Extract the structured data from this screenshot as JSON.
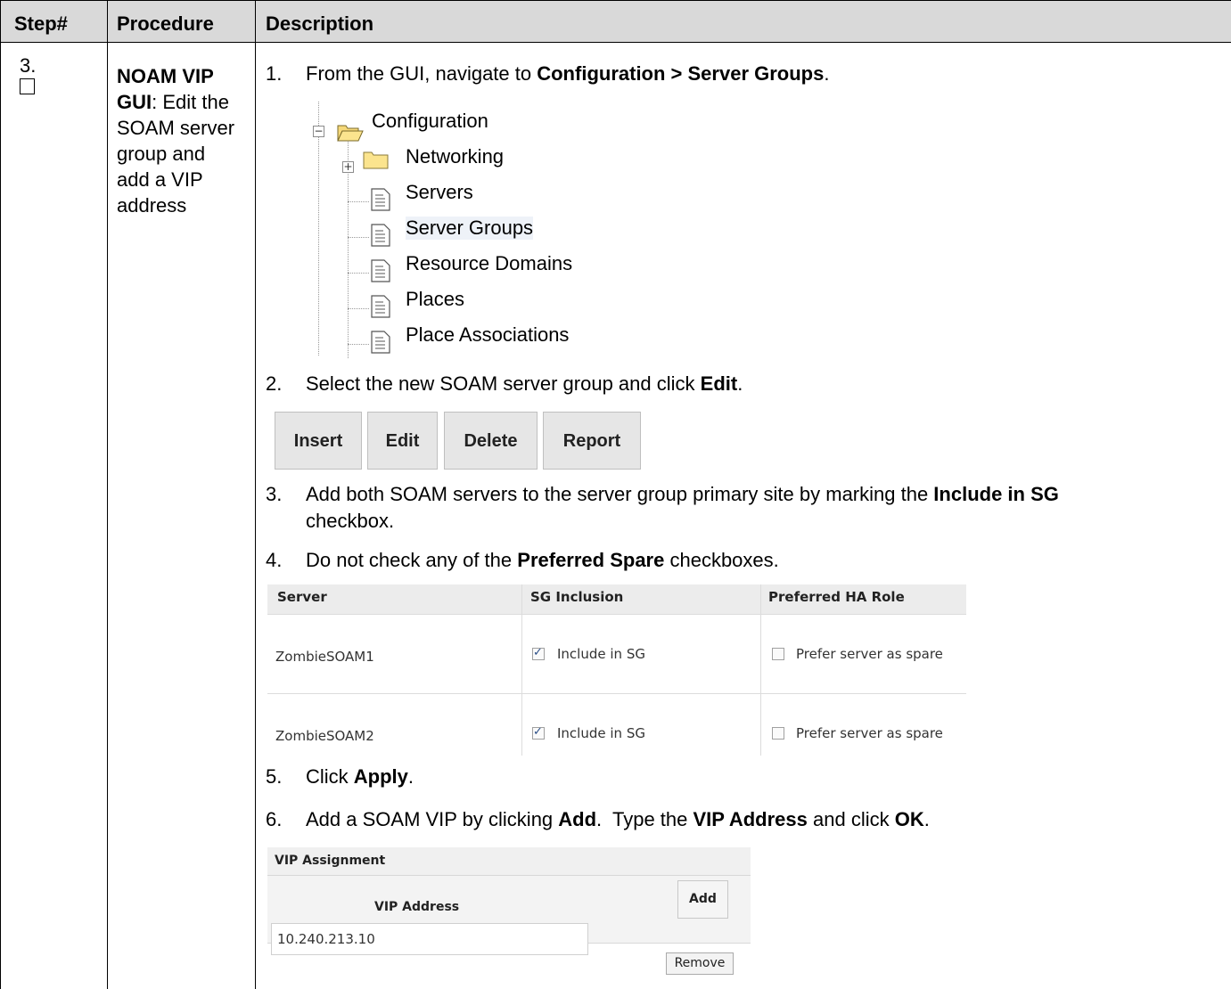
{
  "header": {
    "col_step": "Step#",
    "col_procedure": "Procedure",
    "col_description": "Description"
  },
  "step": {
    "number": "3.",
    "procedure_bold": "NOAM VIP GUI",
    "procedure_rest": ": Edit the SOAM server group and add a VIP address"
  },
  "instructions": [
    {
      "num": "1.",
      "pre": "From the GUI, navigate to ",
      "bold": "Configuration > Server Groups",
      "post": "."
    },
    {
      "num": "2.",
      "pre": "Select the new SOAM server group and click ",
      "bold": "Edit",
      "post": "."
    },
    {
      "num": "3.",
      "pre": "Add both SOAM servers to the server group primary site by marking the ",
      "bold": "Include in SG",
      "post": "",
      "line2": "checkbox."
    },
    {
      "num": "4.",
      "pre": "Do not check any of the ",
      "bold": "Preferred Spare",
      "post": " checkboxes."
    },
    {
      "num": "5.",
      "pre": "Click ",
      "bold": "Apply",
      "post": "."
    },
    {
      "num": "6.",
      "pre": "Add a SOAM VIP by clicking ",
      "bold": "Add",
      "mid": ".  Type the ",
      "bold2": "VIP Address",
      "mid2": " and click ",
      "bold3": "OK",
      "post": "."
    }
  ],
  "tree": {
    "root": "Configuration",
    "children": [
      "Networking",
      "Servers",
      "Server Groups",
      "Resource Domains",
      "Places",
      "Place Associations"
    ],
    "selected": "Server Groups"
  },
  "buttons": [
    "Insert",
    "Edit",
    "Delete",
    "Report"
  ],
  "server_table": {
    "headers": [
      "Server",
      "SG Inclusion",
      "Preferred HA Role"
    ],
    "rows": [
      {
        "server": "ZombieSOAM1",
        "inclusion": "Include in SG",
        "include_checked": true,
        "role": "Prefer server as spare",
        "role_checked": false
      },
      {
        "server": "ZombieSOAM2",
        "inclusion": "Include in SG",
        "include_checked": true,
        "role": "Prefer server as spare",
        "role_checked": false
      }
    ]
  },
  "vip_table": {
    "title": "VIP Assignment",
    "column": "VIP Address",
    "add_label": "Add",
    "address": "10.240.213.10",
    "remove_label": "Remove"
  }
}
